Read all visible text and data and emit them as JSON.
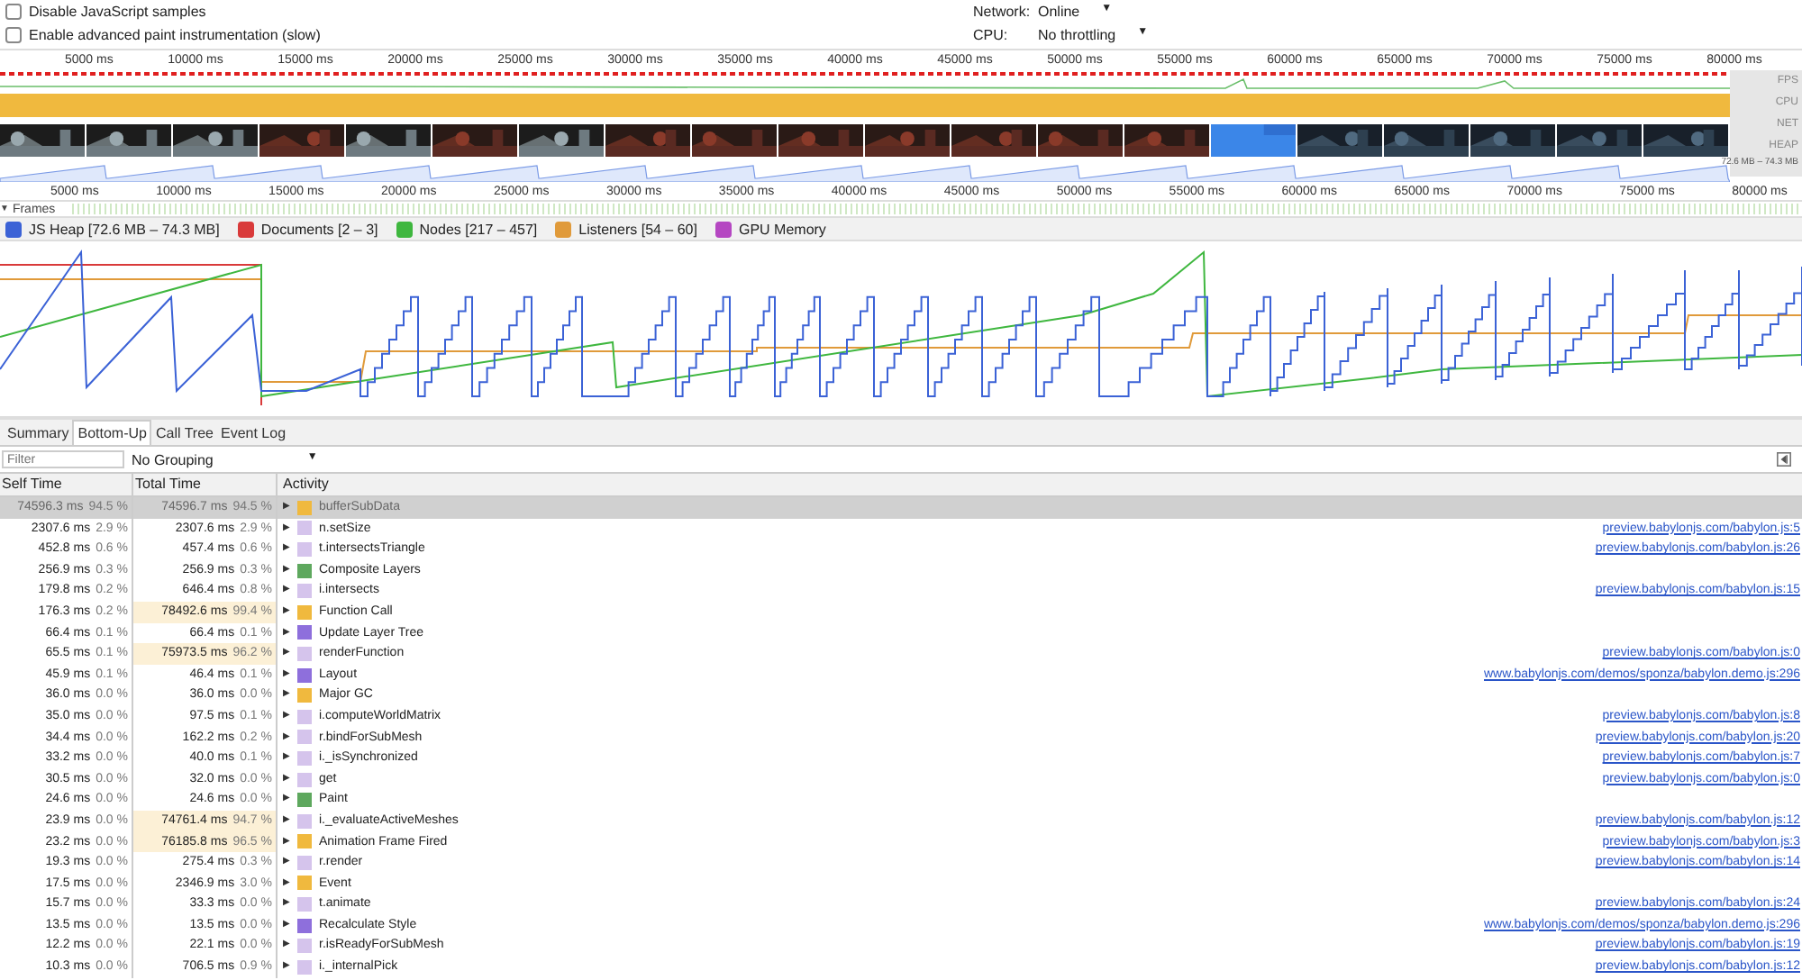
{
  "settings": [
    {
      "label": "Disable JavaScript samples",
      "checked": false
    },
    {
      "label": "Enable advanced paint instrumentation (slow)",
      "checked": false
    }
  ],
  "throttles": [
    {
      "label": "Network:",
      "value": "Online",
      "arrow": "▼"
    },
    {
      "label": "CPU:",
      "value": "No throttling",
      "arrow": "▼"
    }
  ],
  "ruler_ticks": [
    "5000 ms",
    "10000 ms",
    "15000 ms",
    "20000 ms",
    "25000 ms",
    "30000 ms",
    "35000 ms",
    "40000 ms",
    "45000 ms",
    "50000 ms",
    "55000 ms",
    "60000 ms",
    "65000 ms",
    "70000 ms",
    "75000 ms",
    "80000 ms"
  ],
  "track_labels": [
    "FPS",
    "CPU",
    "NET",
    "HEAP"
  ],
  "heap_reading": "72.6 MB – 74.3 MB",
  "bottom_ruler_ticks": [
    "5000 ms",
    "10000 ms",
    "15000 ms",
    "20000 ms",
    "25000 ms",
    "30000 ms",
    "35000 ms",
    "40000 ms",
    "45000 ms",
    "50000 ms",
    "55000 ms",
    "60000 ms",
    "65000 ms",
    "70000 ms",
    "75000 ms",
    "80000 ms"
  ],
  "frames": {
    "arrow": "▼",
    "label": "Frames",
    "expanded": true
  },
  "counters": [
    {
      "label": "JS Heap [72.6 MB – 74.3 MB]",
      "checked": true,
      "color": "#3b62d6"
    },
    {
      "label": "Documents [2 – 3]",
      "checked": true,
      "color": "#d93a3a"
    },
    {
      "label": "Nodes [217 – 457]",
      "checked": true,
      "color": "#3fb73f"
    },
    {
      "label": "Listeners [54 – 60]",
      "checked": true,
      "color": "#e09a3a"
    },
    {
      "label": "GPU Memory",
      "checked": true,
      "color": "#b547c2"
    }
  ],
  "tabs": [
    {
      "label": "Summary",
      "selected": false
    },
    {
      "label": "Bottom-Up",
      "selected": true
    },
    {
      "label": "Call Tree",
      "selected": false
    },
    {
      "label": "Event Log",
      "selected": false
    }
  ],
  "filter": {
    "placeholder": "Filter"
  },
  "grouping": {
    "value": "No Grouping",
    "arrow": "▼"
  },
  "table": {
    "columns": [
      "Self Time",
      "Total Time",
      "Activity"
    ],
    "rows": [
      {
        "self": "74596.3 ms",
        "self_pct": "94.5 %",
        "total": "74596.7 ms",
        "total_pct": "94.5 %",
        "arrow": "▶",
        "color": "#f0b93e",
        "name": "bufferSubData",
        "heavy": false,
        "selected": true
      },
      {
        "self": "2307.6 ms",
        "self_pct": "2.9 %",
        "total": "2307.6 ms",
        "total_pct": "2.9 %",
        "arrow": "▶",
        "color": "#d5c4ec",
        "name": "n.setSize",
        "heavy": false,
        "selected": false,
        "url": "preview.babylonjs.com/babylon.js:5"
      },
      {
        "self": "452.8 ms",
        "self_pct": "0.6 %",
        "total": "457.4 ms",
        "total_pct": "0.6 %",
        "arrow": "▶",
        "color": "#d5c4ec",
        "name": "t.intersectsTriangle",
        "heavy": false,
        "selected": false,
        "url": "preview.babylonjs.com/babylon.js:26"
      },
      {
        "self": "256.9 ms",
        "self_pct": "0.3 %",
        "total": "256.9 ms",
        "total_pct": "0.3 %",
        "arrow": "▶",
        "color": "#5ea85e",
        "name": "Composite Layers",
        "heavy": false,
        "selected": false
      },
      {
        "self": "179.8 ms",
        "self_pct": "0.2 %",
        "total": "646.4 ms",
        "total_pct": "0.8 %",
        "arrow": "▶",
        "color": "#d5c4ec",
        "name": "i.intersects",
        "heavy": false,
        "selected": false,
        "url": "preview.babylonjs.com/babylon.js:15"
      },
      {
        "self": "176.3 ms",
        "self_pct": "0.2 %",
        "total": "78492.6 ms",
        "total_pct": "99.4 %",
        "arrow": "▶",
        "color": "#f0b93e",
        "name": "Function Call",
        "heavy": true,
        "selected": false
      },
      {
        "self": "66.4 ms",
        "self_pct": "0.1 %",
        "total": "66.4 ms",
        "total_pct": "0.1 %",
        "arrow": "▶",
        "color": "#8e6fdc",
        "name": "Update Layer Tree",
        "heavy": false,
        "selected": false
      },
      {
        "self": "65.5 ms",
        "self_pct": "0.1 %",
        "total": "75973.5 ms",
        "total_pct": "96.2 %",
        "arrow": "▶",
        "color": "#d5c4ec",
        "name": "renderFunction",
        "heavy": true,
        "selected": false,
        "url": "preview.babylonjs.com/babylon.js:0"
      },
      {
        "self": "45.9 ms",
        "self_pct": "0.1 %",
        "total": "46.4 ms",
        "total_pct": "0.1 %",
        "arrow": "▶",
        "color": "#8e6fdc",
        "name": "Layout",
        "heavy": false,
        "selected": false,
        "url": "www.babylonjs.com/demos/sponza/babylon.demo.js:296"
      },
      {
        "self": "36.0 ms",
        "self_pct": "0.0 %",
        "total": "36.0 ms",
        "total_pct": "0.0 %",
        "arrow": "▶",
        "color": "#f0b93e",
        "name": "Major GC",
        "heavy": false,
        "selected": false
      },
      {
        "self": "35.0 ms",
        "self_pct": "0.0 %",
        "total": "97.5 ms",
        "total_pct": "0.1 %",
        "arrow": "▶",
        "color": "#d5c4ec",
        "name": "i.computeWorldMatrix",
        "heavy": false,
        "selected": false,
        "url": "preview.babylonjs.com/babylon.js:8"
      },
      {
        "self": "34.4 ms",
        "self_pct": "0.0 %",
        "total": "162.2 ms",
        "total_pct": "0.2 %",
        "arrow": "▶",
        "color": "#d5c4ec",
        "name": "r.bindForSubMesh",
        "heavy": false,
        "selected": false,
        "url": "preview.babylonjs.com/babylon.js:20"
      },
      {
        "self": "33.2 ms",
        "self_pct": "0.0 %",
        "total": "40.0 ms",
        "total_pct": "0.1 %",
        "arrow": "▶",
        "color": "#d5c4ec",
        "name": "i._isSynchronized",
        "heavy": false,
        "selected": false,
        "url": "preview.babylonjs.com/babylon.js:7"
      },
      {
        "self": "30.5 ms",
        "self_pct": "0.0 %",
        "total": "32.0 ms",
        "total_pct": "0.0 %",
        "arrow": "▶",
        "color": "#d5c4ec",
        "name": "get",
        "heavy": false,
        "selected": false,
        "url": "preview.babylonjs.com/babylon.js:0"
      },
      {
        "self": "24.6 ms",
        "self_pct": "0.0 %",
        "total": "24.6 ms",
        "total_pct": "0.0 %",
        "arrow": "▶",
        "color": "#5ea85e",
        "name": "Paint",
        "heavy": false,
        "selected": false
      },
      {
        "self": "23.9 ms",
        "self_pct": "0.0 %",
        "total": "74761.4 ms",
        "total_pct": "94.7 %",
        "arrow": "▶",
        "color": "#d5c4ec",
        "name": "i._evaluateActiveMeshes",
        "heavy": true,
        "selected": false,
        "url": "preview.babylonjs.com/babylon.js:12"
      },
      {
        "self": "23.2 ms",
        "self_pct": "0.0 %",
        "total": "76185.8 ms",
        "total_pct": "96.5 %",
        "arrow": "▶",
        "color": "#f0b93e",
        "name": "Animation Frame Fired",
        "heavy": true,
        "selected": false,
        "url": "preview.babylonjs.com/babylon.js:3"
      },
      {
        "self": "19.3 ms",
        "self_pct": "0.0 %",
        "total": "275.4 ms",
        "total_pct": "0.3 %",
        "arrow": "▶",
        "color": "#d5c4ec",
        "name": "r.render",
        "heavy": false,
        "selected": false,
        "url": "preview.babylonjs.com/babylon.js:14"
      },
      {
        "self": "17.5 ms",
        "self_pct": "0.0 %",
        "total": "2346.9 ms",
        "total_pct": "3.0 %",
        "arrow": "▶",
        "color": "#f0b93e",
        "name": "Event",
        "heavy": false,
        "selected": false
      },
      {
        "self": "15.7 ms",
        "self_pct": "0.0 %",
        "total": "33.3 ms",
        "total_pct": "0.0 %",
        "arrow": "▶",
        "color": "#d5c4ec",
        "name": "t.animate",
        "heavy": false,
        "selected": false,
        "url": "preview.babylonjs.com/babylon.js:24"
      },
      {
        "self": "13.5 ms",
        "self_pct": "0.0 %",
        "total": "13.5 ms",
        "total_pct": "0.0 %",
        "arrow": "▶",
        "color": "#8e6fdc",
        "name": "Recalculate Style",
        "heavy": false,
        "selected": false,
        "url": "www.babylonjs.com/demos/sponza/babylon.demo.js:296"
      },
      {
        "self": "12.2 ms",
        "self_pct": "0.0 %",
        "total": "22.1 ms",
        "total_pct": "0.0 %",
        "arrow": "▶",
        "color": "#d5c4ec",
        "name": "r.isReadyForSubMesh",
        "heavy": false,
        "selected": false,
        "url": "preview.babylonjs.com/babylon.js:19"
      },
      {
        "self": "10.3 ms",
        "self_pct": "0.0 %",
        "total": "706.5 ms",
        "total_pct": "0.9 %",
        "arrow": "▶",
        "color": "#d5c4ec",
        "name": "i._internalPick",
        "heavy": false,
        "selected": false,
        "url": "preview.babylonjs.com/babylon.js:12"
      }
    ]
  }
}
